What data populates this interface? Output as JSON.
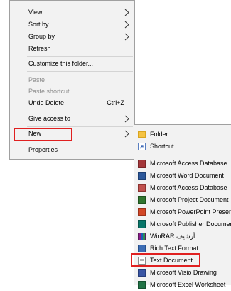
{
  "context_menu": {
    "items": [
      {
        "label": "View"
      },
      {
        "label": "Sort by"
      },
      {
        "label": "Group by"
      },
      {
        "label": "Refresh"
      },
      {
        "label": "Customize this folder..."
      },
      {
        "label": "Paste"
      },
      {
        "label": "Paste shortcut"
      },
      {
        "label": "Undo Delete",
        "shortcut": "Ctrl+Z"
      },
      {
        "label": "Give access to"
      },
      {
        "label": "New"
      },
      {
        "label": "Properties"
      }
    ]
  },
  "new_submenu": {
    "items": [
      {
        "label": "Folder",
        "icon": "folder-icon"
      },
      {
        "label": "Shortcut",
        "icon": "shortcut-icon"
      },
      {
        "label": "Microsoft Access Database",
        "icon": "access-icon"
      },
      {
        "label": "Microsoft Word Document",
        "icon": "word-icon"
      },
      {
        "label": "Microsoft Access Database",
        "icon": "access-icon"
      },
      {
        "label": "Microsoft Project Document",
        "icon": "project-icon"
      },
      {
        "label": "Microsoft PowerPoint Presen",
        "icon": "powerpoint-icon"
      },
      {
        "label": "Microsoft Publisher Documer",
        "icon": "publisher-icon"
      },
      {
        "label": "WinRAR أرشيف",
        "icon": "winrar-icon"
      },
      {
        "label": "Rich Text Format",
        "icon": "rtf-icon"
      },
      {
        "label": "Text Document",
        "icon": "text-document-icon"
      },
      {
        "label": "Microsoft Visio Drawing",
        "icon": "visio-icon"
      },
      {
        "label": "Microsoft Excel Worksheet",
        "icon": "excel-icon"
      }
    ]
  },
  "colors": {
    "highlight": "#e02020",
    "menu_bg": "#f2f2f2",
    "disabled": "#8c8c8c"
  }
}
